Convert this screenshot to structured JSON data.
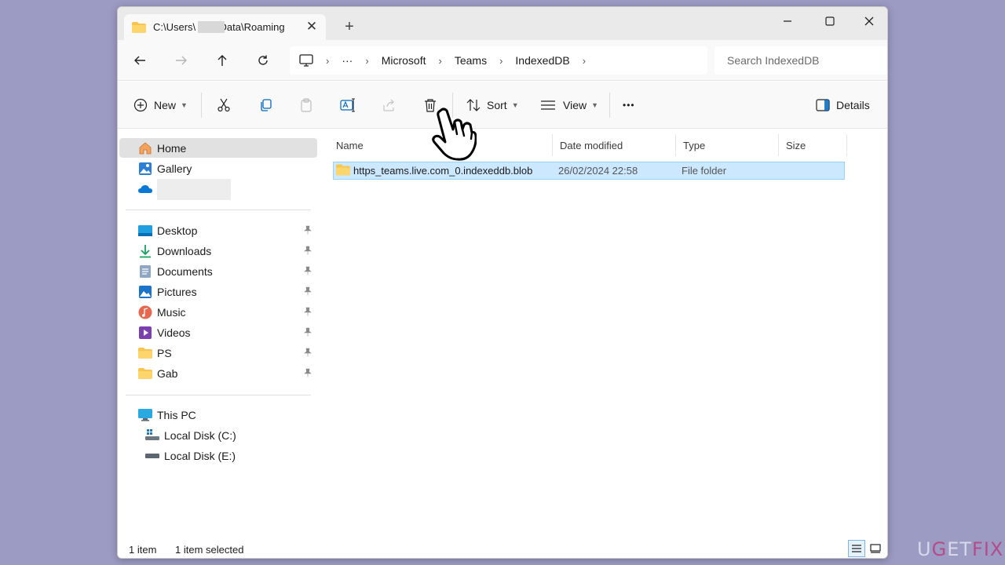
{
  "window": {
    "tab_title": "C:\\Users\\         \\AppData\\Roaming",
    "close_tab_glyph": "✕",
    "new_tab_glyph": "+"
  },
  "controls": {
    "minimize": "—",
    "maximize": "☐",
    "close": "✕"
  },
  "addressbar": {
    "breadcrumb": [
      "Microsoft",
      "Teams",
      "IndexedDB"
    ],
    "more": "···",
    "search_placeholder": "Search IndexedDB"
  },
  "commandbar": {
    "new_label": "New",
    "sort_label": "Sort",
    "view_label": "View",
    "more_label": "•••",
    "details_label": "Details"
  },
  "sidebar": {
    "top": [
      {
        "label": "Home",
        "icon": "home-icon"
      },
      {
        "label": "Gallery",
        "icon": "gallery-icon"
      },
      {
        "label": "",
        "icon": "onedrive-icon"
      }
    ],
    "quick_access": [
      {
        "label": "Desktop",
        "icon": "desktop-icon"
      },
      {
        "label": "Downloads",
        "icon": "downloads-icon"
      },
      {
        "label": "Documents",
        "icon": "documents-icon"
      },
      {
        "label": "Pictures",
        "icon": "pictures-icon"
      },
      {
        "label": "Music",
        "icon": "music-icon"
      },
      {
        "label": "Videos",
        "icon": "videos-icon"
      },
      {
        "label": "PS",
        "icon": "folder-icon"
      },
      {
        "label": "Gab",
        "icon": "folder-icon"
      }
    ],
    "this_pc": {
      "label": "This PC",
      "icon": "this-pc-icon"
    },
    "drives": [
      {
        "label": "Local Disk (C:)",
        "icon": "drive-c-icon"
      },
      {
        "label": "Local Disk (E:)",
        "icon": "drive-icon"
      }
    ]
  },
  "filelist": {
    "columns": [
      "Name",
      "Date modified",
      "Type",
      "Size"
    ],
    "rows": [
      {
        "name": "https_teams.live.com_0.indexeddb.blob",
        "date": "26/02/2024 22:58",
        "type": "File folder",
        "size": ""
      }
    ]
  },
  "statusbar": {
    "count": "1 item",
    "selected": "1 item selected"
  },
  "watermark": {
    "p1": "U",
    "p2": "G",
    "p3": "ET",
    "p4": "FIX"
  },
  "colors": {
    "selection_bg": "#cce8ff",
    "folder": "#f8c650",
    "accent": "#0067c0"
  }
}
